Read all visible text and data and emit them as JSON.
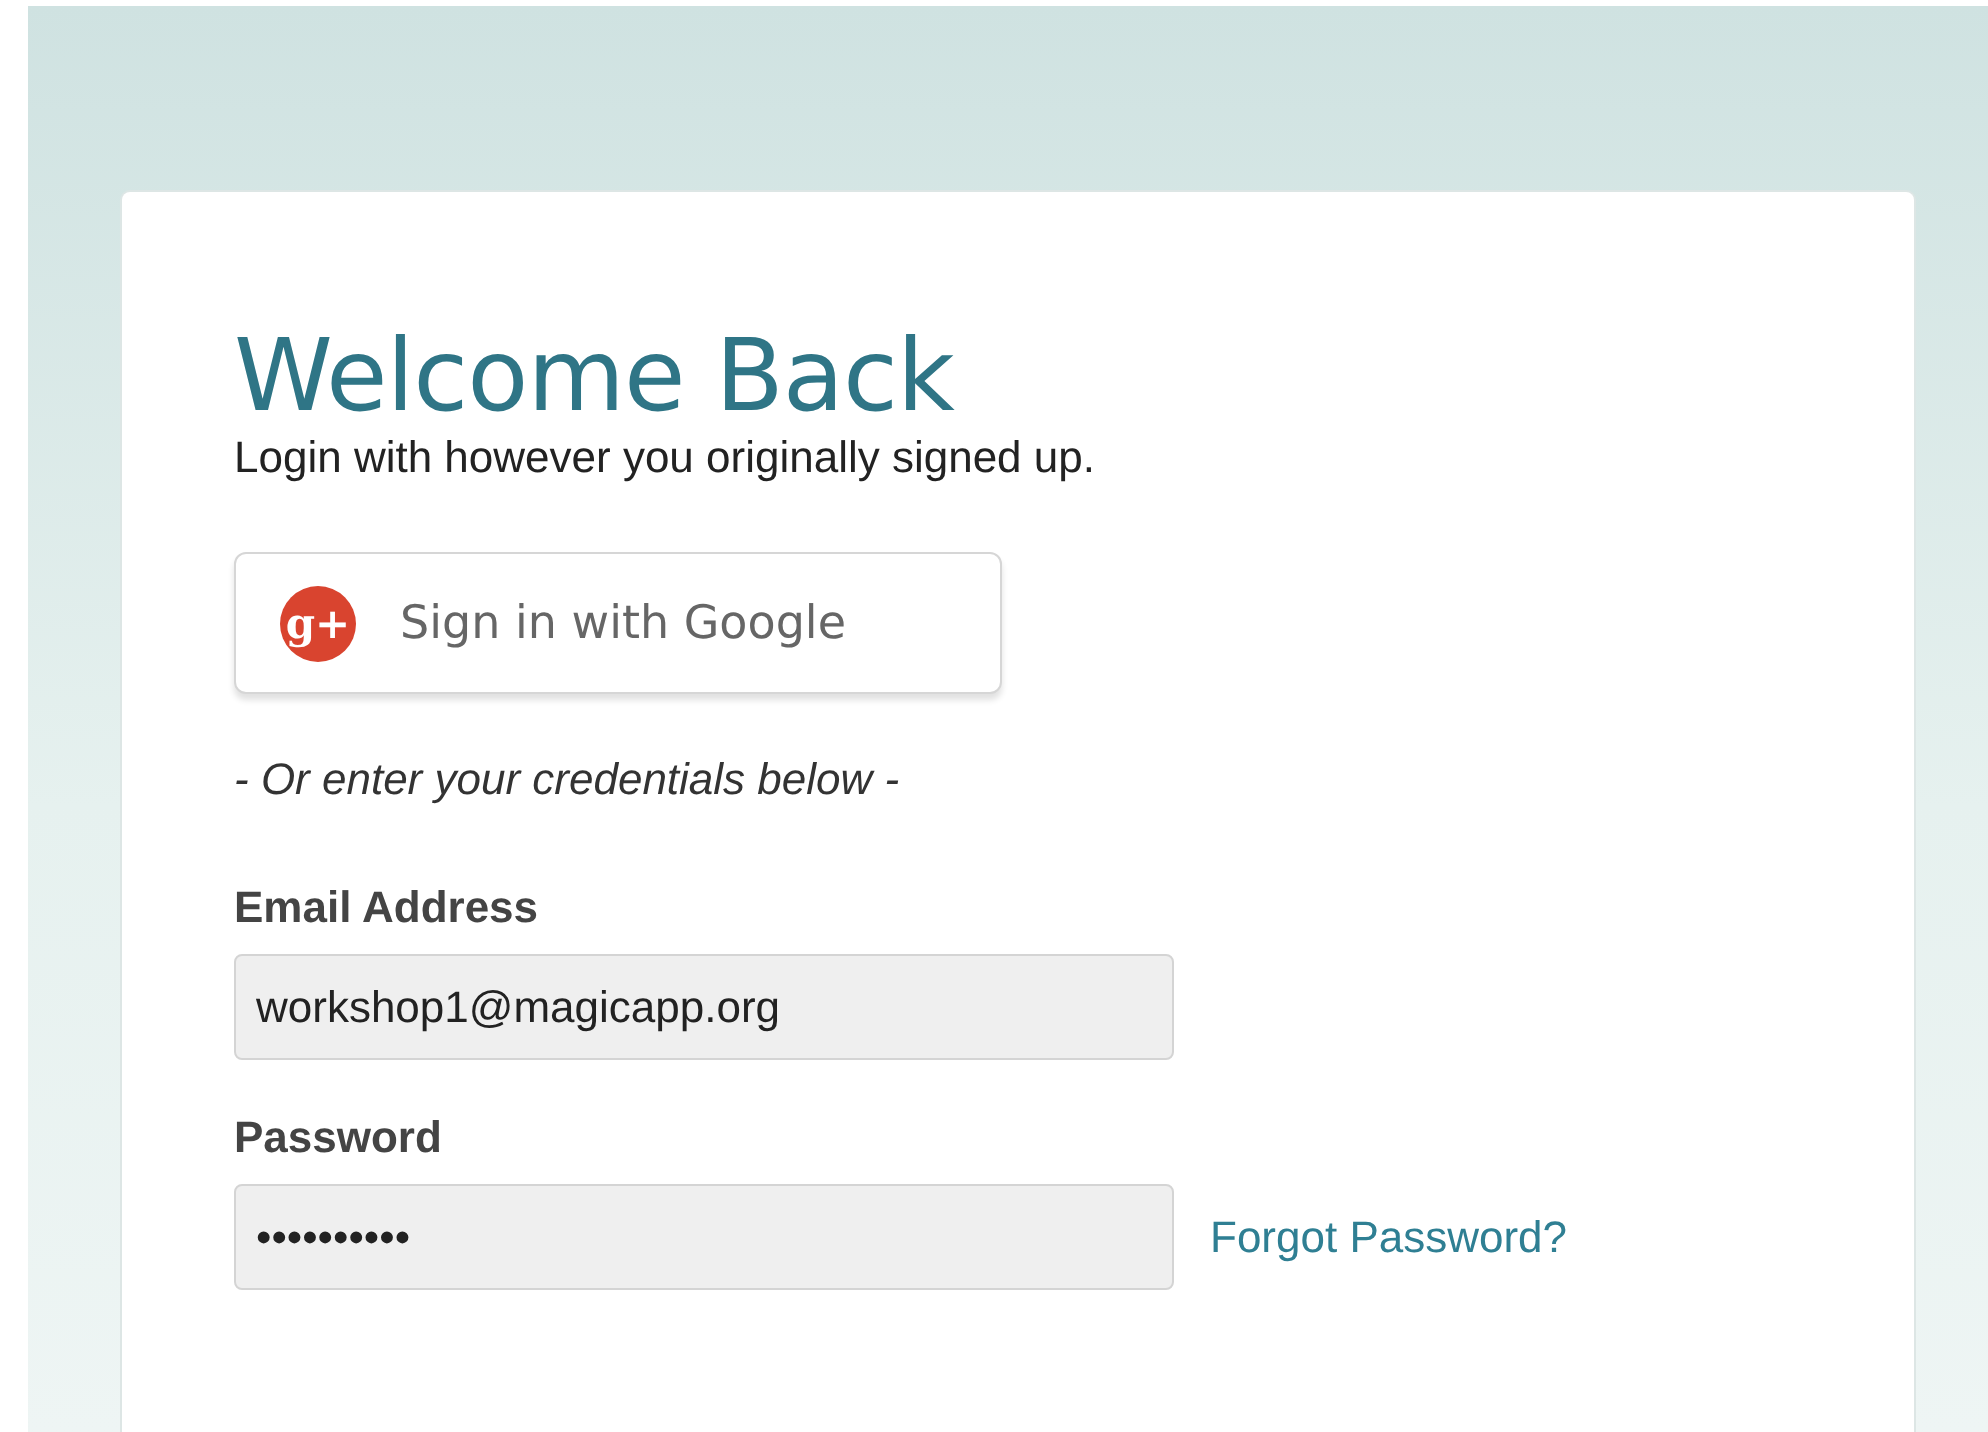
{
  "title": "Welcome Back",
  "subtitle": "Login with however you originally signed up.",
  "google_button": {
    "icon_text": "g+",
    "label": "Sign in with Google"
  },
  "divider_text": "- Or enter your credentials below -",
  "fields": [
    {
      "label": "Email Address",
      "value": "workshop1@magicapp.org"
    },
    {
      "label": "Password",
      "value": "••••••••••",
      "link": "Forgot Password?"
    }
  ]
}
